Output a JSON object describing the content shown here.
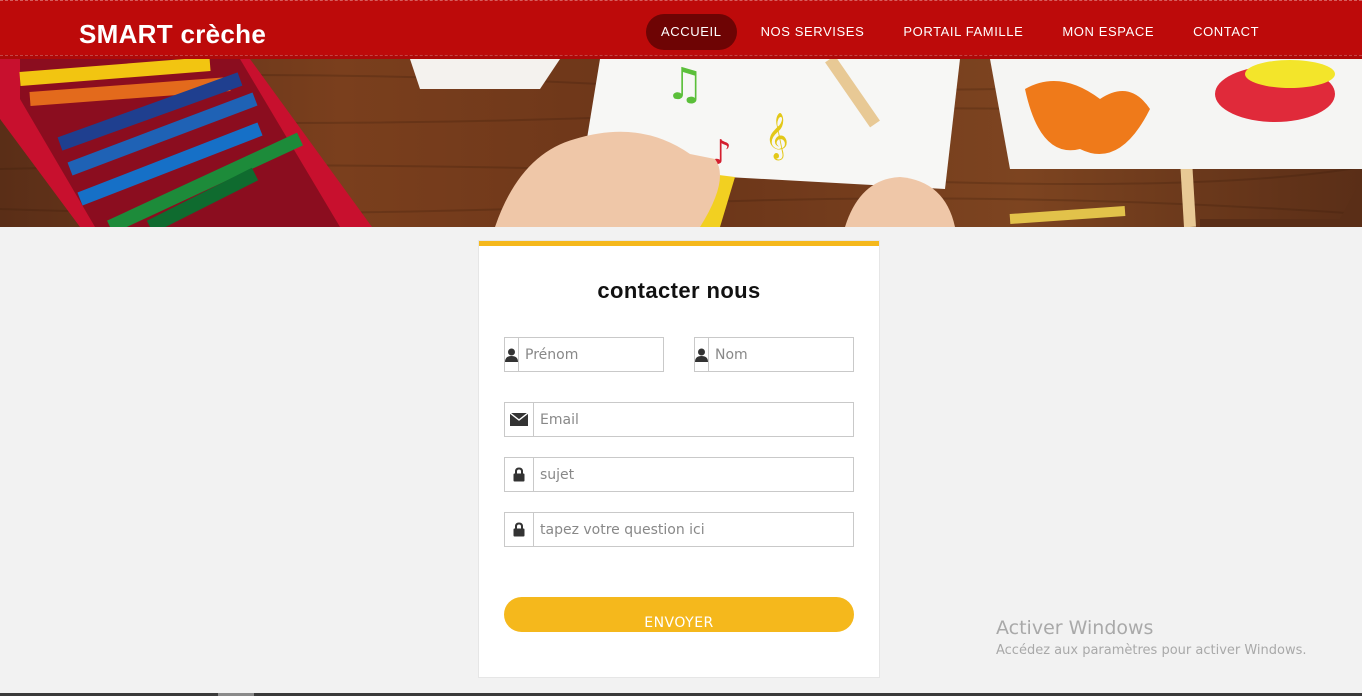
{
  "header": {
    "brand": "SMART crèche",
    "nav": [
      {
        "label": "ACCUEIL",
        "active": true
      },
      {
        "label": "NOS SERVISES",
        "active": false
      },
      {
        "label": "PORTAIL FAMILLE",
        "active": false
      },
      {
        "label": "MON ESPACE",
        "active": false
      },
      {
        "label": "CONTACT",
        "active": false
      }
    ]
  },
  "colors": {
    "navbar": "#bd0a0a",
    "active_nav": "#6e0404",
    "accent": "#f5b81c",
    "background": "#f2f2f2"
  },
  "hero": {
    "icon": "children-drawing-banner"
  },
  "form": {
    "title": "contacter nous",
    "fields": {
      "prenom": {
        "placeholder": "Prénom",
        "value": "",
        "icon": "user-icon"
      },
      "nom": {
        "placeholder": "Nom",
        "value": "",
        "icon": "user-icon"
      },
      "email": {
        "placeholder": "Email",
        "value": "",
        "icon": "envelope-icon"
      },
      "sujet": {
        "placeholder": "sujet",
        "value": "",
        "icon": "lock-icon"
      },
      "question": {
        "placeholder": "tapez votre question ici",
        "value": "",
        "icon": "lock-icon"
      }
    },
    "submit_label": "ENVOYER"
  },
  "watermark": {
    "title": "Activer Windows",
    "subtitle": "Accédez aux paramètres pour activer Windows."
  }
}
